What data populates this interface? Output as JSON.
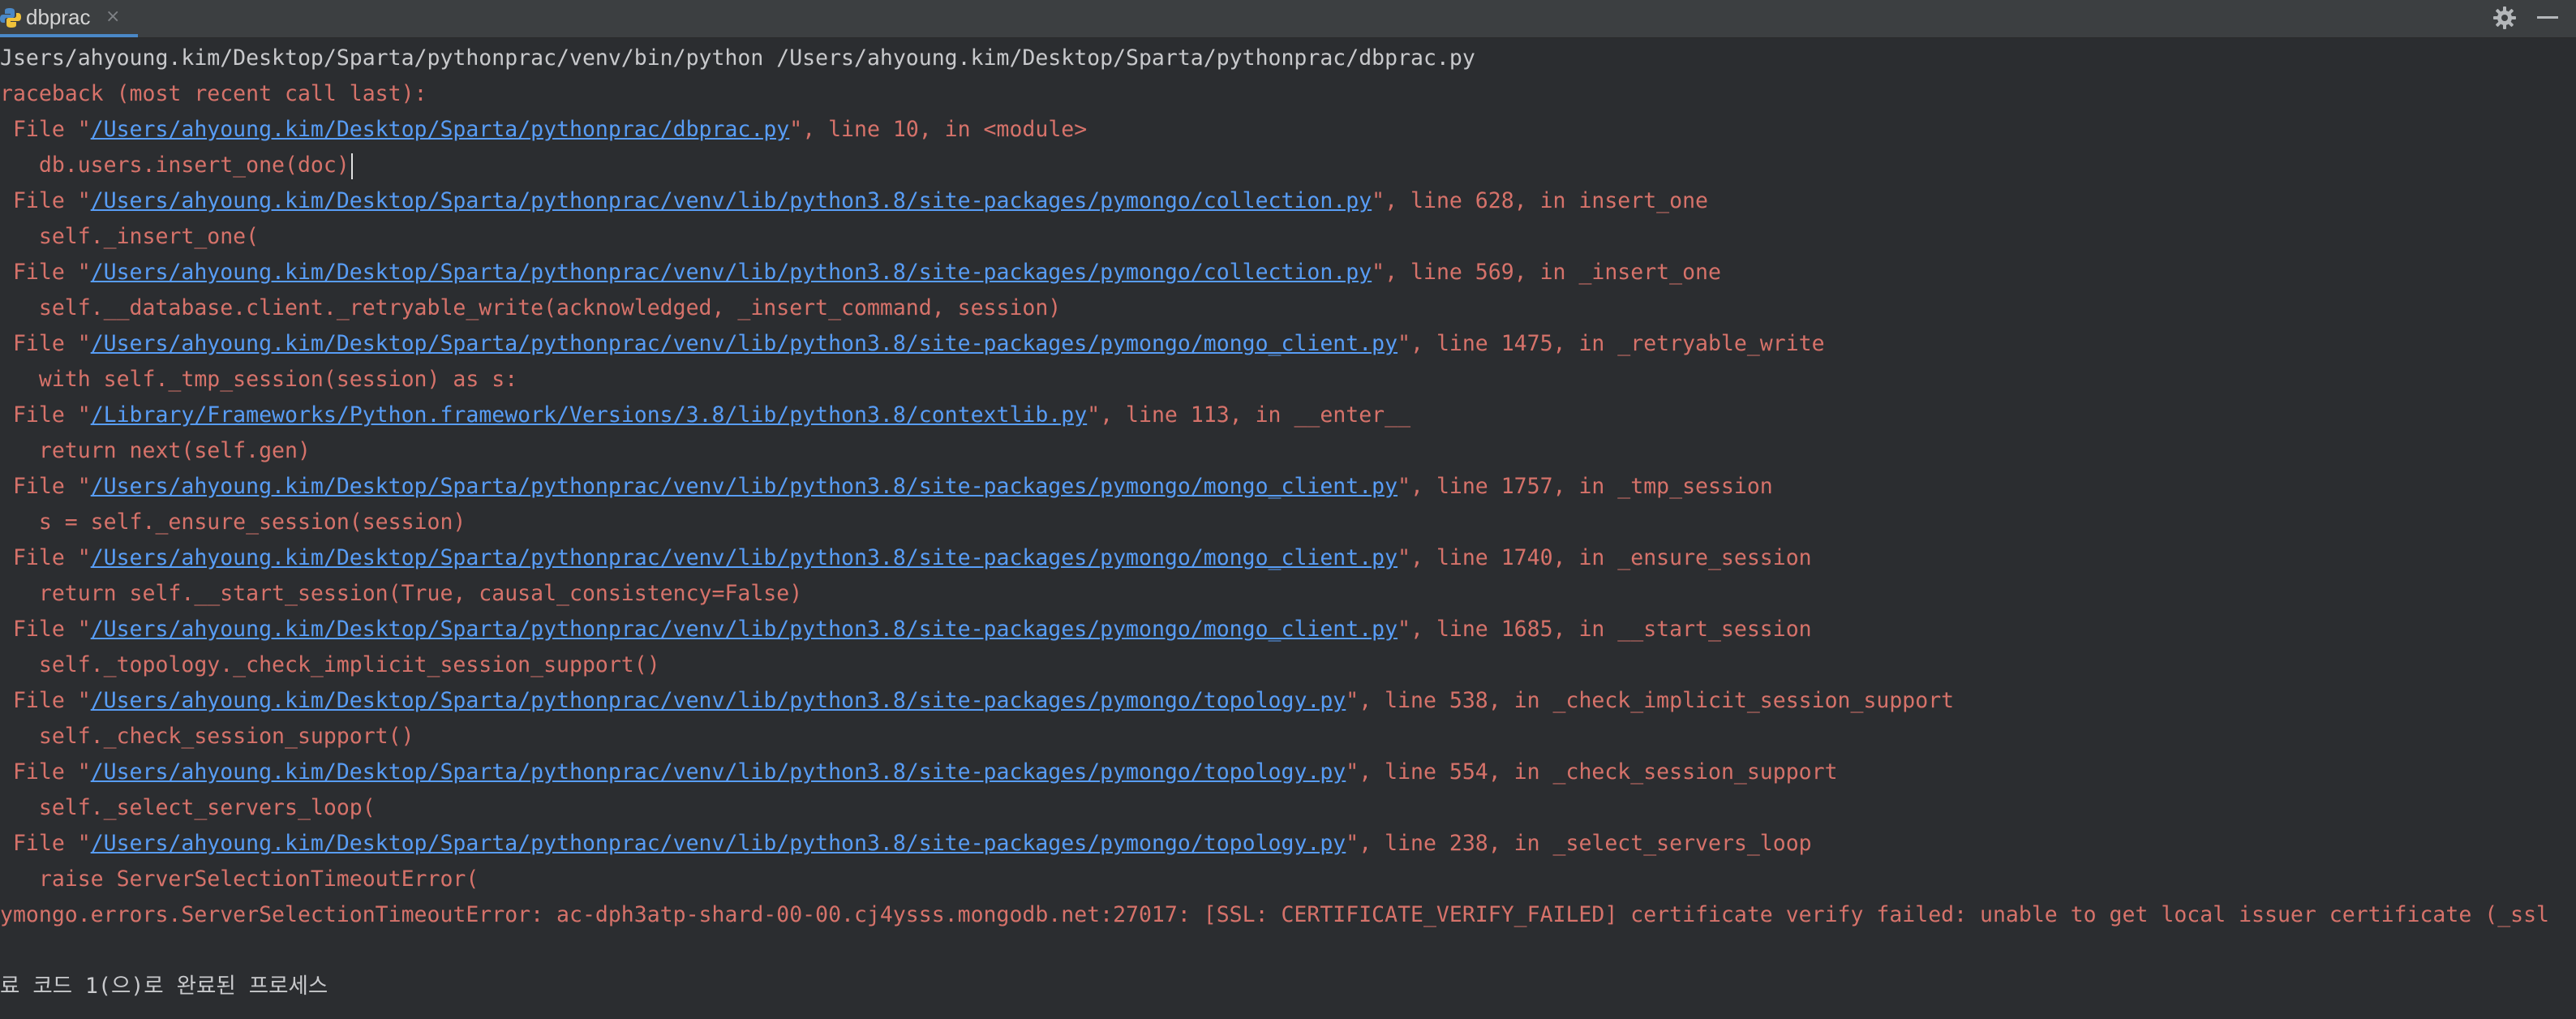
{
  "tab": {
    "label": "dbprac",
    "close_icon": "×",
    "icon": "python-file-icon"
  },
  "toolbar": {
    "settings_icon": "gear-icon",
    "minimize_icon": "minimize-icon"
  },
  "colors": {
    "background": "#2b2d30",
    "error_text": "#d6726a",
    "link": "#589df6",
    "plain_text": "#c8c9cc"
  },
  "console": {
    "command": "Jsers/ahyoung.kim/Desktop/Sparta/pythonprac/venv/bin/python /Users/ahyoung.kim/Desktop/Sparta/pythonprac/dbprac.py",
    "traceback_header": "raceback (most recent call last):",
    "frames": [
      {
        "prefix": " File \"",
        "path": "/Users/ahyoung.kim/Desktop/Sparta/pythonprac/dbprac.py",
        "suffix": "\", line 10, in <module>",
        "code": "   db.users.insert_one(doc)"
      },
      {
        "prefix": " File \"",
        "path": "/Users/ahyoung.kim/Desktop/Sparta/pythonprac/venv/lib/python3.8/site-packages/pymongo/collection.py",
        "suffix": "\", line 628, in insert_one",
        "code": "   self._insert_one("
      },
      {
        "prefix": " File \"",
        "path": "/Users/ahyoung.kim/Desktop/Sparta/pythonprac/venv/lib/python3.8/site-packages/pymongo/collection.py",
        "suffix": "\", line 569, in _insert_one",
        "code": "   self.__database.client._retryable_write(acknowledged, _insert_command, session)"
      },
      {
        "prefix": " File \"",
        "path": "/Users/ahyoung.kim/Desktop/Sparta/pythonprac/venv/lib/python3.8/site-packages/pymongo/mongo_client.py",
        "suffix": "\", line 1475, in _retryable_write",
        "code": "   with self._tmp_session(session) as s:"
      },
      {
        "prefix": " File \"",
        "path": "/Library/Frameworks/Python.framework/Versions/3.8/lib/python3.8/contextlib.py",
        "suffix": "\", line 113, in __enter__",
        "code": "   return next(self.gen)"
      },
      {
        "prefix": " File \"",
        "path": "/Users/ahyoung.kim/Desktop/Sparta/pythonprac/venv/lib/python3.8/site-packages/pymongo/mongo_client.py",
        "suffix": "\", line 1757, in _tmp_session",
        "code": "   s = self._ensure_session(session)"
      },
      {
        "prefix": " File \"",
        "path": "/Users/ahyoung.kim/Desktop/Sparta/pythonprac/venv/lib/python3.8/site-packages/pymongo/mongo_client.py",
        "suffix": "\", line 1740, in _ensure_session",
        "code": "   return self.__start_session(True, causal_consistency=False)"
      },
      {
        "prefix": " File \"",
        "path": "/Users/ahyoung.kim/Desktop/Sparta/pythonprac/venv/lib/python3.8/site-packages/pymongo/mongo_client.py",
        "suffix": "\", line 1685, in __start_session",
        "code": "   self._topology._check_implicit_session_support()"
      },
      {
        "prefix": " File \"",
        "path": "/Users/ahyoung.kim/Desktop/Sparta/pythonprac/venv/lib/python3.8/site-packages/pymongo/topology.py",
        "suffix": "\", line 538, in _check_implicit_session_support",
        "code": "   self._check_session_support()"
      },
      {
        "prefix": " File \"",
        "path": "/Users/ahyoung.kim/Desktop/Sparta/pythonprac/venv/lib/python3.8/site-packages/pymongo/topology.py",
        "suffix": "\", line 554, in _check_session_support",
        "code": "   self._select_servers_loop("
      },
      {
        "prefix": " File \"",
        "path": "/Users/ahyoung.kim/Desktop/Sparta/pythonprac/venv/lib/python3.8/site-packages/pymongo/topology.py",
        "suffix": "\", line 238, in _select_servers_loop",
        "code": "   raise ServerSelectionTimeoutError("
      }
    ],
    "exception": "ymongo.errors.ServerSelectionTimeoutError: ac-dph3atp-shard-00-00.cj4ysss.mongodb.net:27017: [SSL: CERTIFICATE_VERIFY_FAILED] certificate verify failed: unable to get local issuer certificate (_ssl",
    "exit_message": "료 코드 1(으)로 완료된 프로세스"
  }
}
